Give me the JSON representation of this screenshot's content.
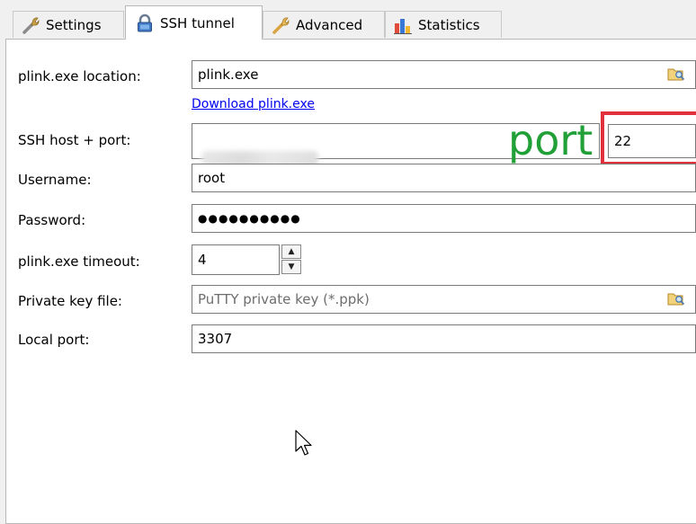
{
  "tabs": [
    {
      "label": "Settings",
      "icon": "wrench-icon"
    },
    {
      "label": "SSH tunnel",
      "icon": "lock-icon"
    },
    {
      "label": "Advanced",
      "icon": "wrench-icon"
    },
    {
      "label": "Statistics",
      "icon": "bar-chart-icon"
    }
  ],
  "active_tab": "SSH tunnel",
  "form": {
    "plink_location_label": "plink.exe location:",
    "plink_location_value": "plink.exe",
    "download_link": "Download plink.exe",
    "ssh_host_label": "SSH host + port:",
    "ssh_port_value": "22",
    "username_label": "Username:",
    "username_value": "root",
    "password_label": "Password:",
    "password_value": "●●●●●●●●●●",
    "timeout_label": "plink.exe timeout:",
    "timeout_value": "4",
    "private_key_label": "Private key file:",
    "private_key_placeholder": "PuTTY private key (*.ppk)",
    "local_port_label": "Local port:",
    "local_port_value": "3307"
  },
  "annotation": {
    "text": "port",
    "text_color": "#22a038",
    "box_color": "#e0313c"
  }
}
